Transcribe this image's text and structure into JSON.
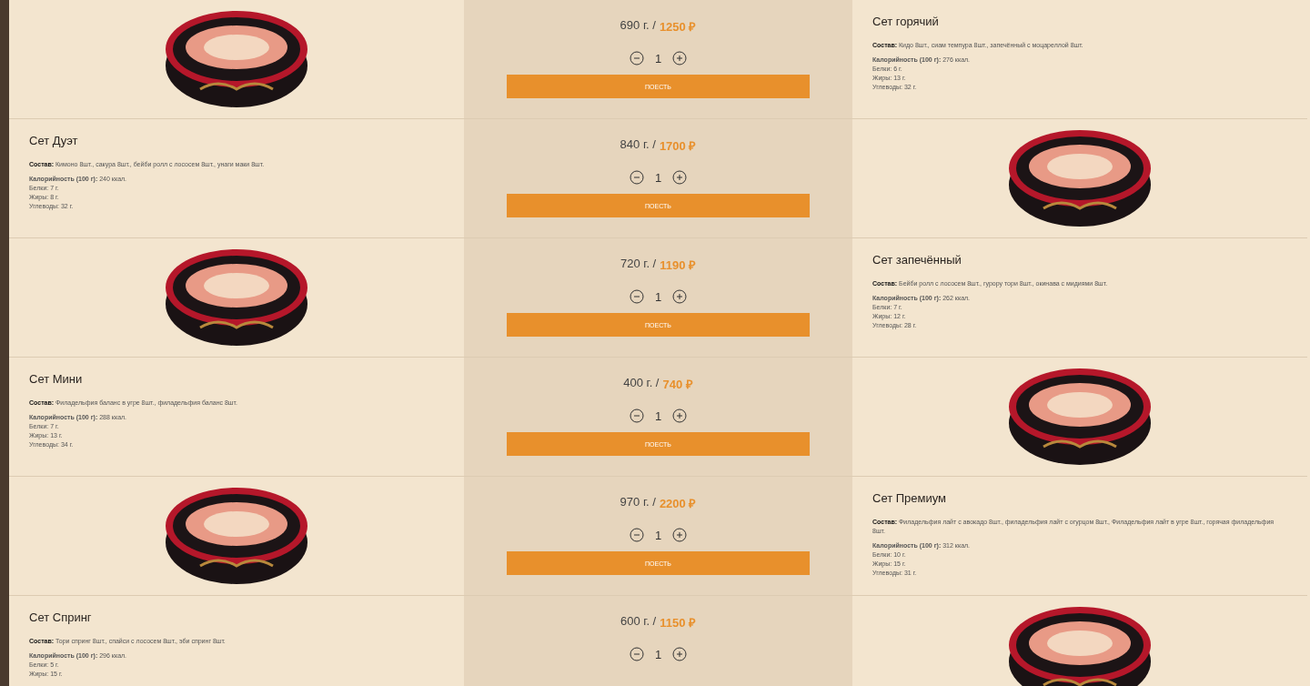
{
  "products": [
    {
      "kind": "left",
      "title": "Сет горячий",
      "composition": "**Состав:** Кидо 8шт., сиам темпура 8шт., запечённый с моцареллой 8шт.",
      "calories": "**Калорийность (100 г):** 276 ккал.",
      "nutrients": [
        "Белки: 6 г.",
        "Жиры: 13 г.",
        "Углеводы: 32 г."
      ],
      "weight": "690 г. /",
      "price": "1250 ₽",
      "quantity": "1",
      "button": "ПОЕСТЬ"
    },
    {
      "kind": "right",
      "title": "Сет Дуэт",
      "composition": "**Состав:** Кимоно 8шт., сакура 8шт., бейби ролл с лососем 8шт., унаги маки 8шт.",
      "calories": "**Калорийность (100 г):** 240 ккал.",
      "nutrients": [
        "Белки: 7 г.",
        "Жиры: 8 г.",
        "Углеводы: 32 г."
      ],
      "weight": "840 г. /",
      "price": "1700 ₽",
      "quantity": "1",
      "button": "ПОЕСТЬ"
    },
    {
      "kind": "left",
      "title": "Сет запечённый",
      "composition": "**Состав:** Бейби ролл с лососем 8шт., гурору тори 8шт., окинава с мидиями 8шт.",
      "calories": "**Калорийность (100 г):** 262 ккал.",
      "nutrients": [
        "Белки: 7 г.",
        "Жиры: 12 г.",
        "Углеводы: 28 г."
      ],
      "weight": "720 г. /",
      "price": "1190 ₽",
      "quantity": "1",
      "button": "ПОЕСТЬ"
    },
    {
      "kind": "right",
      "title": "Сет Мини",
      "composition": "**Состав:** Филадельфия баланс в угре 8шт., филадельфия баланс 8шт.",
      "calories": "**Калорийность (100 г):** 288 ккал.",
      "nutrients": [
        "Белки: 7 г.",
        "Жиры: 13 г.",
        "Углеводы: 34 г."
      ],
      "weight": "400 г. /",
      "price": "740 ₽",
      "quantity": "1",
      "button": "ПОЕСТЬ"
    },
    {
      "kind": "left",
      "title": "Сет Премиум",
      "composition": "**Состав:** Филадельфия лайт с авокадо 8шт., филадельфия лайт с огурцом 8шт., Филадельфия лайт в угре 8шт., горячая филадельфия 8шт.",
      "calories": "**Калорийность (100 г):** 312 ккал.",
      "nutrients": [
        "Белки: 10 г.",
        "Жиры: 15 г.",
        "Углеводы: 31 г."
      ],
      "weight": "970 г. /",
      "price": "2200 ₽",
      "quantity": "1",
      "button": "ПОЕСТЬ"
    },
    {
      "kind": "right",
      "title": "Сет Спринг",
      "composition": "**Состав:** Тори спринг 8шт., спайси с лососем 8шт., эби спринг 8шт.",
      "calories": "**Калорийность (100 г):** 296 ккал.",
      "nutrients": [
        "Белки: 5 г.",
        "Жиры: 15 г."
      ],
      "weight": "600 г. /",
      "price": "1150 ₽",
      "quantity": "1"
    }
  ]
}
